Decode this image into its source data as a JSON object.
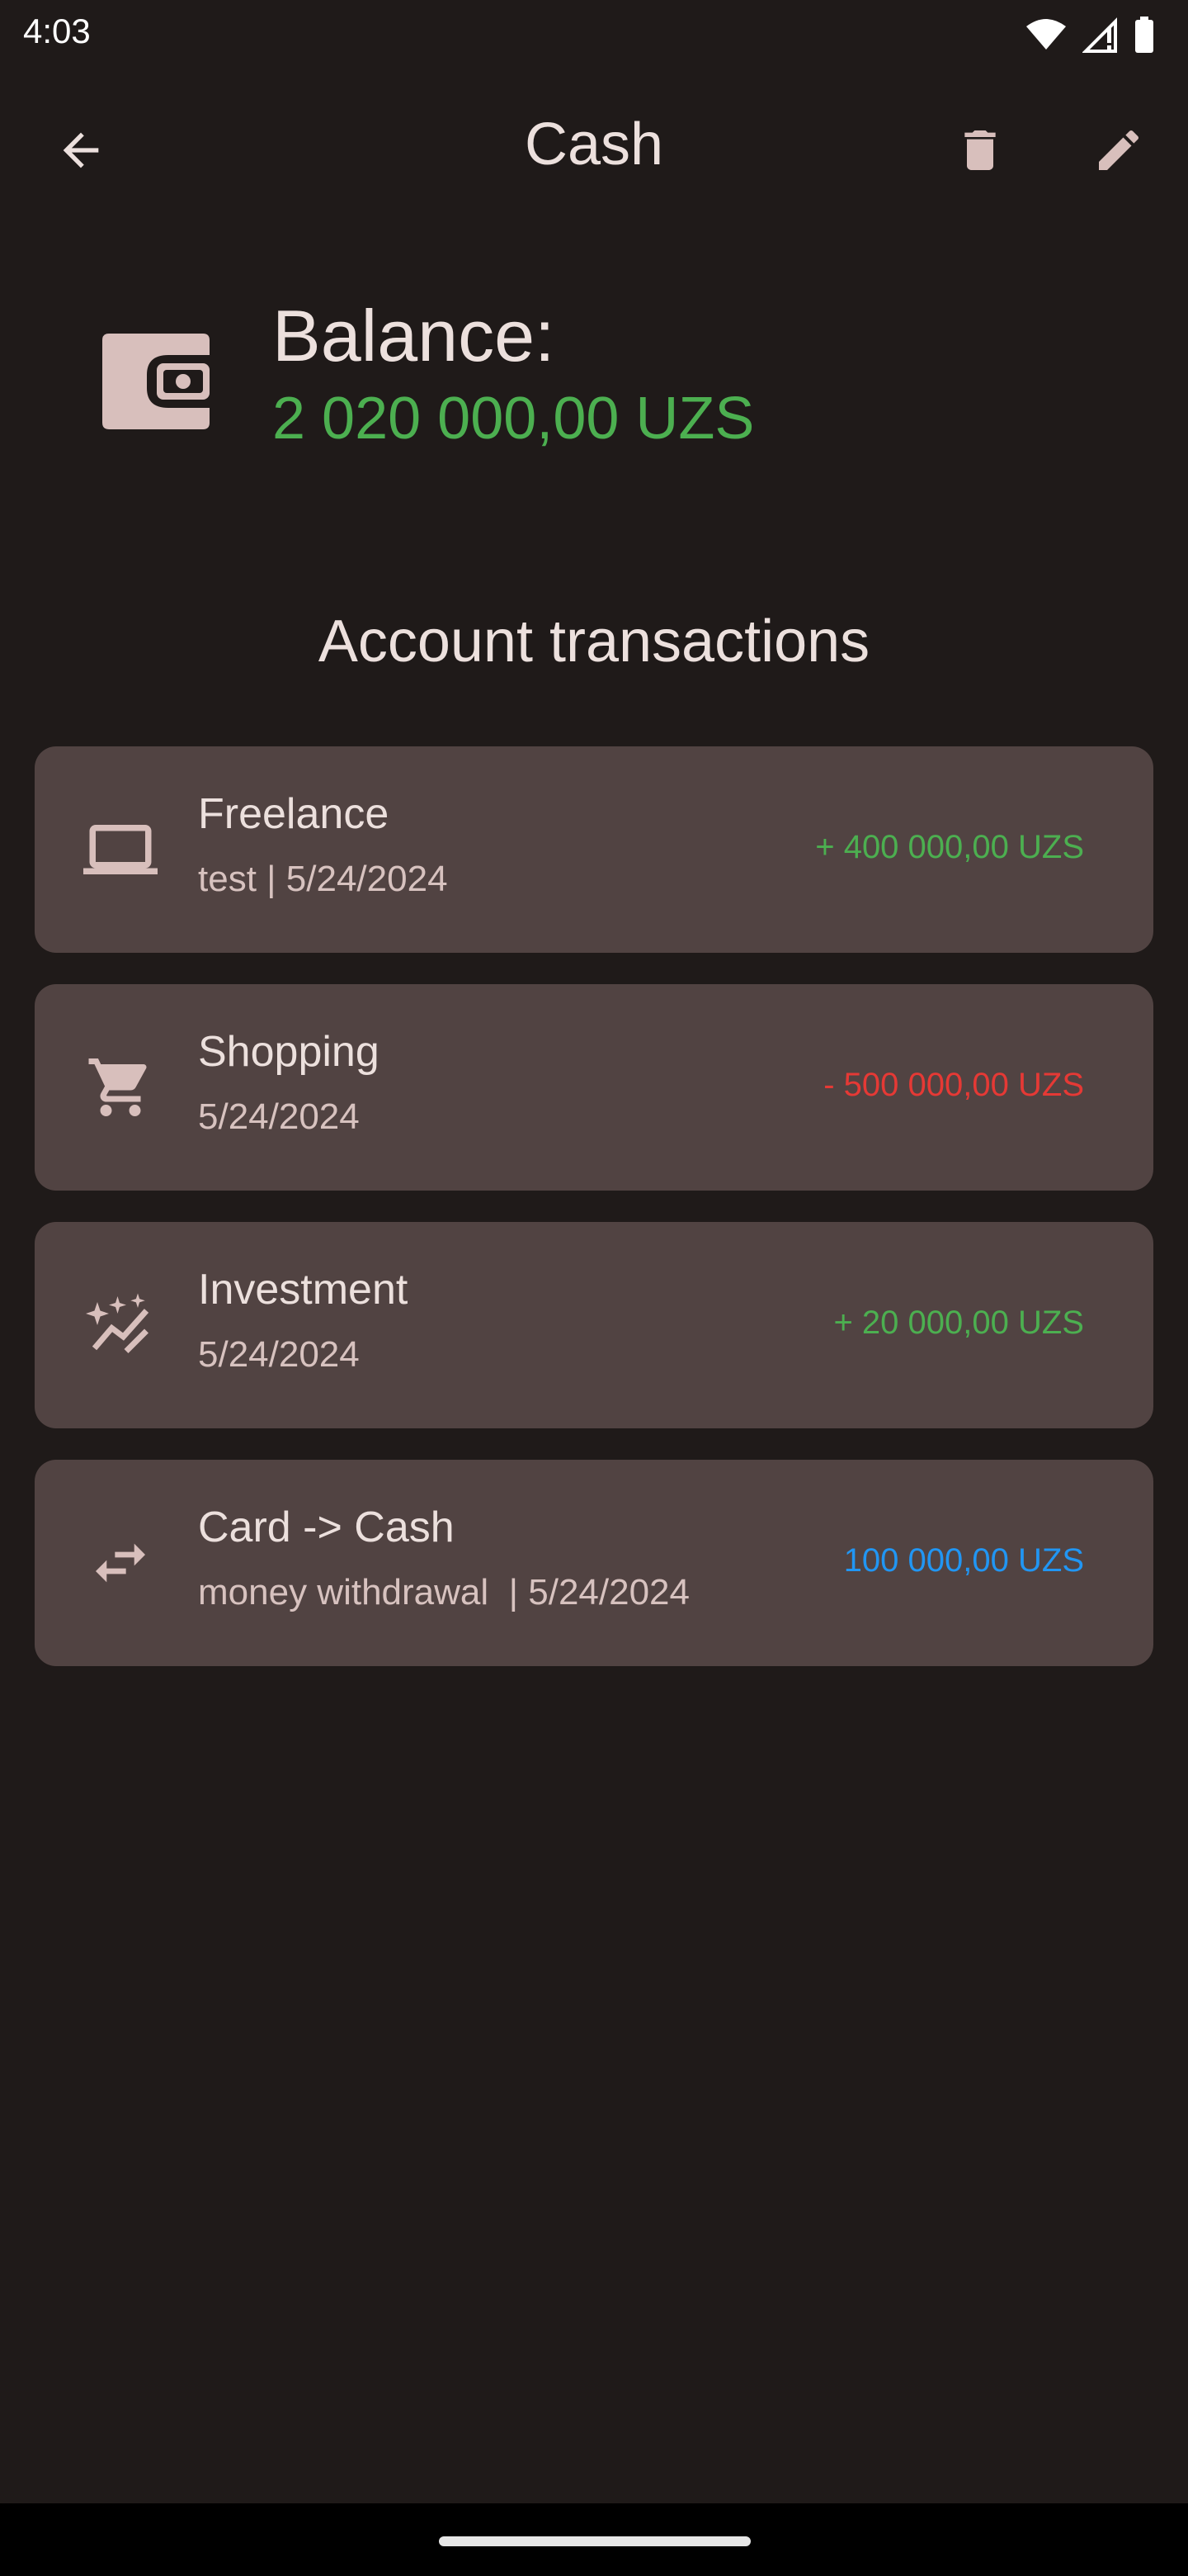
{
  "status_bar": {
    "time": "4:03",
    "icons": [
      "wifi-icon",
      "cellular-signal-icon",
      "battery-icon"
    ]
  },
  "app_bar": {
    "title": "Cash",
    "actions": [
      "back-arrow-icon",
      "delete-icon",
      "edit-icon"
    ]
  },
  "balance": {
    "label": "Balance:",
    "value": "2 020 000,00 UZS",
    "icon": "wallet-icon",
    "value_color": "#4caf50"
  },
  "transactions_section": {
    "title": "Account transactions",
    "items": [
      {
        "icon": "laptop-icon",
        "title": "Freelance",
        "subtitle": "test | 5/24/2024",
        "amount": "+ 400 000,00 UZS",
        "amount_color": "#4caf50"
      },
      {
        "icon": "shopping-cart-icon",
        "title": "Shopping",
        "subtitle": "5/24/2024",
        "amount": "- 500 000,00 UZS",
        "amount_color": "#e53935"
      },
      {
        "icon": "investment-trend-icon",
        "title": "Investment",
        "subtitle": "5/24/2024",
        "amount": "+ 20 000,00 UZS",
        "amount_color": "#4caf50"
      },
      {
        "icon": "transfer-arrows-icon",
        "title": "Card -> Cash",
        "subtitle": "money withdrawal  | 5/24/2024",
        "amount": "100 000,00 UZS",
        "amount_color": "#2196f3"
      }
    ]
  },
  "colors": {
    "background": "#1f1a19",
    "card": "#514342",
    "on_surface": "#ece0dd",
    "icon_tint": "#d8bfbc"
  }
}
